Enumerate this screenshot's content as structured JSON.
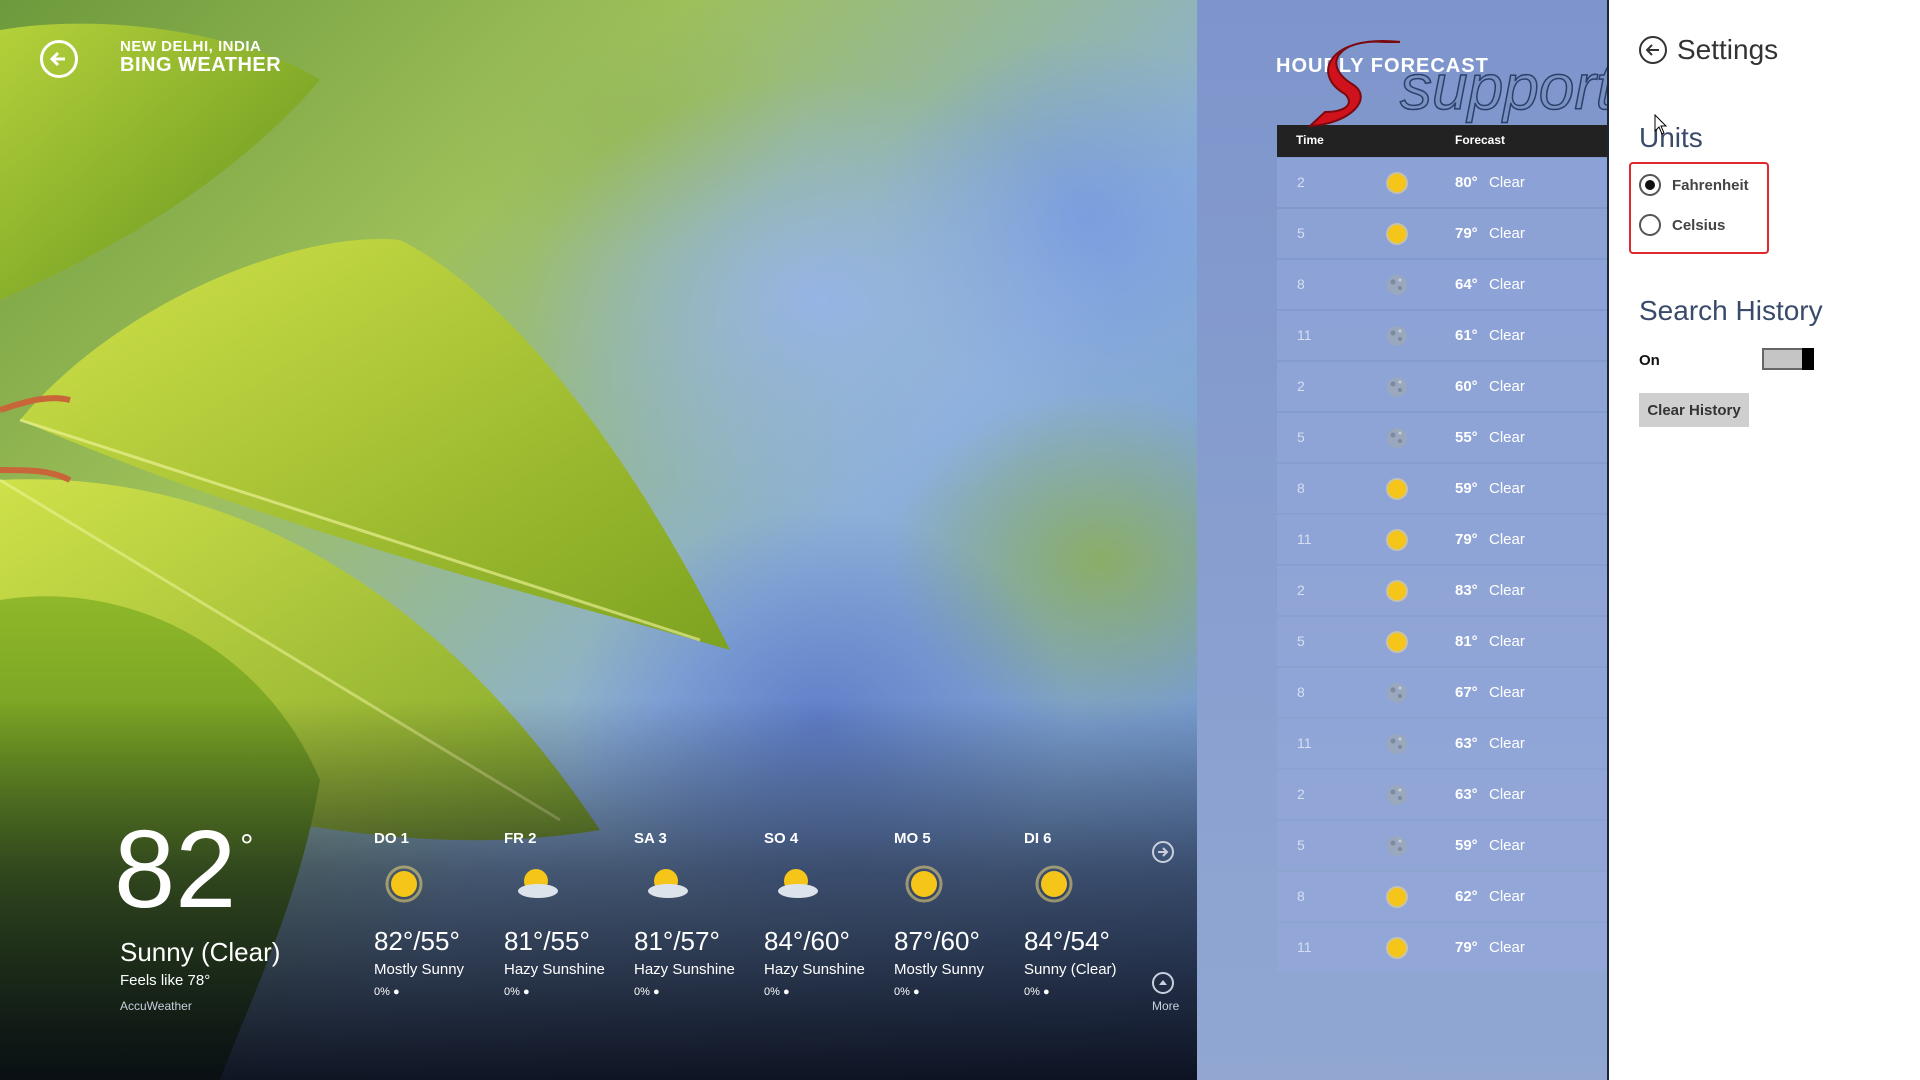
{
  "app": {
    "city": "NEW DELHI, INDIA",
    "name": "BING WEATHER"
  },
  "current": {
    "temp": "82",
    "degree": "°",
    "condition": "Sunny (Clear)",
    "feels_like": "Feels like 78°",
    "source": "AccuWeather"
  },
  "daily": [
    {
      "day": "DO 1",
      "temps": "82°/55°",
      "condition": "Mostly Sunny",
      "precip": "0%",
      "icon": "sun-icon"
    },
    {
      "day": "FR 2",
      "temps": "81°/55°",
      "condition": "Hazy Sunshine",
      "precip": "0%",
      "icon": "hazy-sun-icon"
    },
    {
      "day": "SA 3",
      "temps": "81°/57°",
      "condition": "Hazy Sunshine",
      "precip": "0%",
      "icon": "hazy-sun-icon"
    },
    {
      "day": "SO 4",
      "temps": "84°/60°",
      "condition": "Hazy Sunshine",
      "precip": "0%",
      "icon": "hazy-sun-icon"
    },
    {
      "day": "MO 5",
      "temps": "87°/60°",
      "condition": "Mostly Sunny",
      "precip": "0%",
      "icon": "sun-icon"
    },
    {
      "day": "DI 6",
      "temps": "84°/54°",
      "condition": "Sunny (Clear)",
      "precip": "0%",
      "icon": "sun-icon"
    }
  ],
  "more_label": "More",
  "hourly": {
    "title": "HOURLY FORECAST",
    "col_time": "Time",
    "col_forecast": "Forecast",
    "rows": [
      {
        "time": "2",
        "temp": "80°",
        "cond": "Clear",
        "icon": "sun"
      },
      {
        "time": "5",
        "temp": "79°",
        "cond": "Clear",
        "icon": "sun"
      },
      {
        "time": "8",
        "temp": "64°",
        "cond": "Clear",
        "icon": "moon"
      },
      {
        "time": "11",
        "temp": "61°",
        "cond": "Clear",
        "icon": "moon"
      },
      {
        "time": "2",
        "temp": "60°",
        "cond": "Clear",
        "icon": "moon"
      },
      {
        "time": "5",
        "temp": "55°",
        "cond": "Clear",
        "icon": "moon"
      },
      {
        "time": "8",
        "temp": "59°",
        "cond": "Clear",
        "icon": "sun"
      },
      {
        "time": "11",
        "temp": "79°",
        "cond": "Clear",
        "icon": "sun"
      },
      {
        "time": "2",
        "temp": "83°",
        "cond": "Clear",
        "icon": "sun"
      },
      {
        "time": "5",
        "temp": "81°",
        "cond": "Clear",
        "icon": "sun"
      },
      {
        "time": "8",
        "temp": "67°",
        "cond": "Clear",
        "icon": "moon"
      },
      {
        "time": "11",
        "temp": "63°",
        "cond": "Clear",
        "icon": "moon"
      },
      {
        "time": "2",
        "temp": "63°",
        "cond": "Clear",
        "icon": "moon"
      },
      {
        "time": "5",
        "temp": "59°",
        "cond": "Clear",
        "icon": "moon"
      },
      {
        "time": "8",
        "temp": "62°",
        "cond": "Clear",
        "icon": "sun"
      },
      {
        "time": "11",
        "temp": "79°",
        "cond": "Clear",
        "icon": "sun"
      }
    ]
  },
  "settings": {
    "title": "Settings",
    "units_heading": "Units",
    "unit_options": [
      "Fahrenheit",
      "Celsius"
    ],
    "selected_unit": "Fahrenheit",
    "search_history_heading": "Search History",
    "toggle_label": "On",
    "toggle_state": "on",
    "clear_button": "Clear History"
  },
  "watermark": "supportnet",
  "colors": {
    "highlight_border": "#e0282e",
    "hourly_panel": "#7e95cc",
    "table_header": "#222222"
  }
}
